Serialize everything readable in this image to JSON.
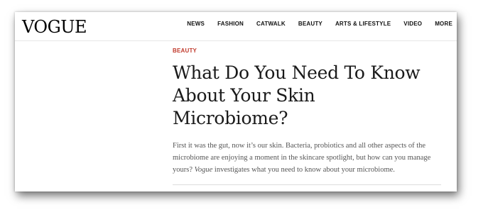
{
  "site": {
    "logo": "VOGUE"
  },
  "nav": {
    "items": [
      "NEWS",
      "FASHION",
      "CATWALK",
      "BEAUTY",
      "ARTS & LIFESTYLE",
      "VIDEO",
      "MORE"
    ]
  },
  "article": {
    "kicker": "BEAUTY",
    "title_line1": "What Do You Need To Know",
    "title_line2": "About Your Skin",
    "title_line3": "Microbiome?",
    "dek_part1": "First it was the gut, now it’s our skin. Bacteria, probiotics and all other aspects of the microbiome are enjoying a moment in the skincare spotlight, but how can you manage yours? ",
    "dek_italic": "Vogue",
    "dek_part2": " investigates what you need to know about your microbiome."
  },
  "colors": {
    "kicker": "#c0392b",
    "headline": "#1a1a1a",
    "body": "#555555"
  }
}
